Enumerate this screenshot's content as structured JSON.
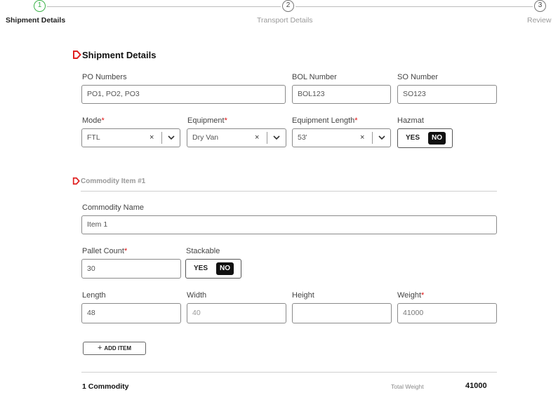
{
  "stepper": {
    "steps": [
      {
        "num": "1",
        "label": "Shipment Details"
      },
      {
        "num": "2",
        "label": "Transport Details"
      },
      {
        "num": "3",
        "label": "Review"
      }
    ]
  },
  "shipment": {
    "title": "Shipment Details",
    "po_label": "PO Numbers",
    "po_value": "PO1, PO2, PO3",
    "bol_label": "BOL Number",
    "bol_value": "BOL123",
    "so_label": "SO Number",
    "so_value": "SO123",
    "mode_label": "Mode",
    "mode_value": "FTL",
    "equipment_label": "Equipment",
    "equipment_value": "Dry Van",
    "equipment_length_label": "Equipment Length",
    "equipment_length_value": "53'",
    "hazmat_label": "Hazmat",
    "hazmat_yes": "YES",
    "hazmat_no": "NO",
    "required_mark": "*",
    "clear_glyph": "×"
  },
  "commodity": {
    "title": "Commodity Item #1",
    "name_label": "Commodity Name",
    "name_value": "Item 1",
    "pallet_label": "Pallet Count",
    "pallet_value": "30",
    "stackable_label": "Stackable",
    "stackable_yes": "YES",
    "stackable_no": "NO",
    "length_label": "Length",
    "length_value": "48",
    "width_label": "Width",
    "width_value": "40",
    "height_label": "Height",
    "height_value": "",
    "weight_label": "Weight",
    "weight_value": "41000",
    "add_item_plus": "+",
    "add_item_label": "ADD ITEM"
  },
  "summary": {
    "count_label": "1 Commodity",
    "total_weight_label": "Total Weight",
    "total_weight_value": "41000"
  },
  "colors": {
    "active_step": "#3cb34a",
    "marker": "#e02020",
    "toggle_selected": "#111111"
  },
  "icons": [
    "step-circle",
    "location-marker-icon",
    "clear-icon",
    "chevron-down-icon",
    "plus-icon"
  ]
}
